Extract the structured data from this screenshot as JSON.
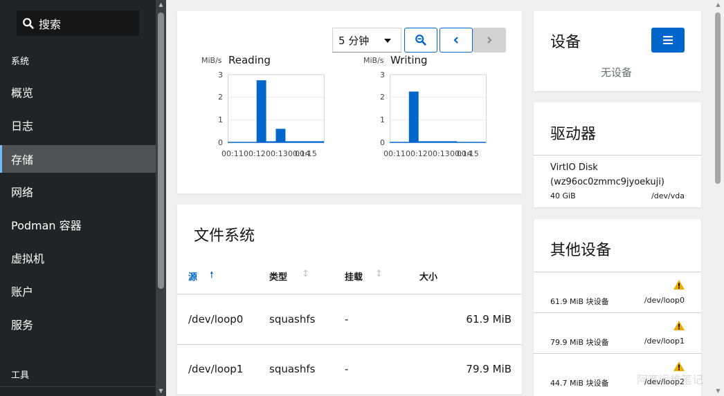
{
  "sidebar": {
    "search_label": "搜索",
    "section_system": "系统",
    "items": [
      {
        "label": "概览",
        "active": false
      },
      {
        "label": "日志",
        "active": false
      },
      {
        "label": "存储",
        "active": true
      },
      {
        "label": "网络",
        "active": false
      },
      {
        "label": "Podman 容器",
        "active": false
      },
      {
        "label": "虚拟机",
        "active": false
      },
      {
        "label": "账户",
        "active": false
      },
      {
        "label": "服务",
        "active": false
      }
    ],
    "section_tools": "工具"
  },
  "graph_controls": {
    "range_value": "5 分钟"
  },
  "chart_data": [
    {
      "type": "bar",
      "title": "Reading",
      "ylabel": "MiB/s",
      "yticks": [
        "0",
        "1",
        "2",
        "3"
      ],
      "ylim": [
        0,
        3
      ],
      "xticks": [
        "00:11",
        "00:12",
        "00:13",
        "00:14",
        "00:15"
      ],
      "x_range": [
        "00:10:30",
        "00:15:30"
      ],
      "values": [
        {
          "start": "00:10:30",
          "end": "00:12",
          "value": 0
        },
        {
          "start": "00:12",
          "end": "00:12:30",
          "value": 2.75
        },
        {
          "start": "00:12:30",
          "end": "00:13",
          "value": 0.05
        },
        {
          "start": "00:13",
          "end": "00:13:30",
          "value": 0.6
        },
        {
          "start": "00:13:30",
          "end": "00:15:30",
          "value": 0.05
        }
      ]
    },
    {
      "type": "bar",
      "title": "Writing",
      "ylabel": "MiB/s",
      "yticks": [
        "0",
        "1",
        "2",
        "3"
      ],
      "ylim": [
        0,
        3
      ],
      "xticks": [
        "00:11",
        "00:12",
        "00:13",
        "00:14",
        "00:15"
      ],
      "x_range": [
        "00:10:30",
        "00:15:30"
      ],
      "values": [
        {
          "start": "00:10:30",
          "end": "00:11:30",
          "value": 0
        },
        {
          "start": "00:11:30",
          "end": "00:12",
          "value": 2.25
        },
        {
          "start": "00:12",
          "end": "00:14",
          "value": 0.05
        },
        {
          "start": "00:14",
          "end": "00:15:30",
          "value": 0
        }
      ]
    }
  ],
  "filesystems": {
    "title": "文件系统",
    "columns": [
      {
        "label": "源",
        "sorted": true
      },
      {
        "label": "类型",
        "sorted": false
      },
      {
        "label": "挂载",
        "sorted": false
      },
      {
        "label": "大小",
        "sorted": false
      }
    ],
    "rows": [
      {
        "source": "/dev/loop0",
        "type": "squashfs",
        "mount": "-",
        "size": "61.9 MiB"
      },
      {
        "source": "/dev/loop1",
        "type": "squashfs",
        "mount": "-",
        "size": "79.9 MiB"
      }
    ]
  },
  "devices": {
    "title": "设备",
    "empty_text": "无设备"
  },
  "drives": {
    "title": "驱动器",
    "items": [
      {
        "name": "VirtIO Disk",
        "id": "(wz96oc0zmmc9jyoekuji)",
        "size": "40 GiB",
        "path": "/dev/vda"
      }
    ]
  },
  "other_devices": {
    "title": "其他设备",
    "items": [
      {
        "label": "61.9 MiB 块设备",
        "path": "/dev/loop0"
      },
      {
        "label": "79.9 MiB 块设备",
        "path": "/dev/loop1"
      },
      {
        "label": "44.7 MiB 块设备",
        "path": "/dev/loop2"
      }
    ]
  },
  "watermark": "阿髙运维笔记",
  "colors": {
    "accent": "#0066cc",
    "warning": "#f0ab00",
    "sidebar_bg": "#212427"
  }
}
